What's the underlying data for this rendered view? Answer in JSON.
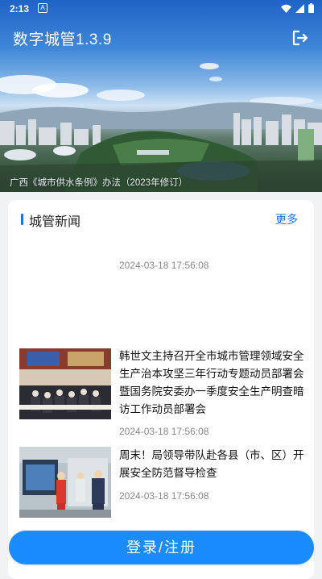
{
  "status_bar": {
    "time": "2:13",
    "notification_letter": "A"
  },
  "header": {
    "app_title": "数字城管1.3.9",
    "banner_caption": "广西《城市供水条例》办法（2023年修订）"
  },
  "news": {
    "section_title": "城管新闻",
    "more_label": "更多",
    "items": [
      {
        "title": "",
        "date": "2024-03-18 17:56:08"
      },
      {
        "title": "韩世文主持召开全市城市管理领域安全生产治本攻坚三年行动专题动员部署会暨国务院安委办一季度安全生产明查暗访工作动员部署会",
        "date": "2024-03-18 17:56:08"
      },
      {
        "title": "周末！局领导带队赴各县（市、区）开展安全防范督导检查",
        "date": "2024-03-18 17:56:08"
      }
    ]
  },
  "login_button": {
    "label": "登录/注册"
  },
  "colors": {
    "accent": "#1a73e8",
    "button": "#1a8cff",
    "background": "#f1f2f4"
  },
  "icons": [
    "wifi-icon",
    "signal-icon",
    "battery-icon",
    "logout-icon"
  ]
}
